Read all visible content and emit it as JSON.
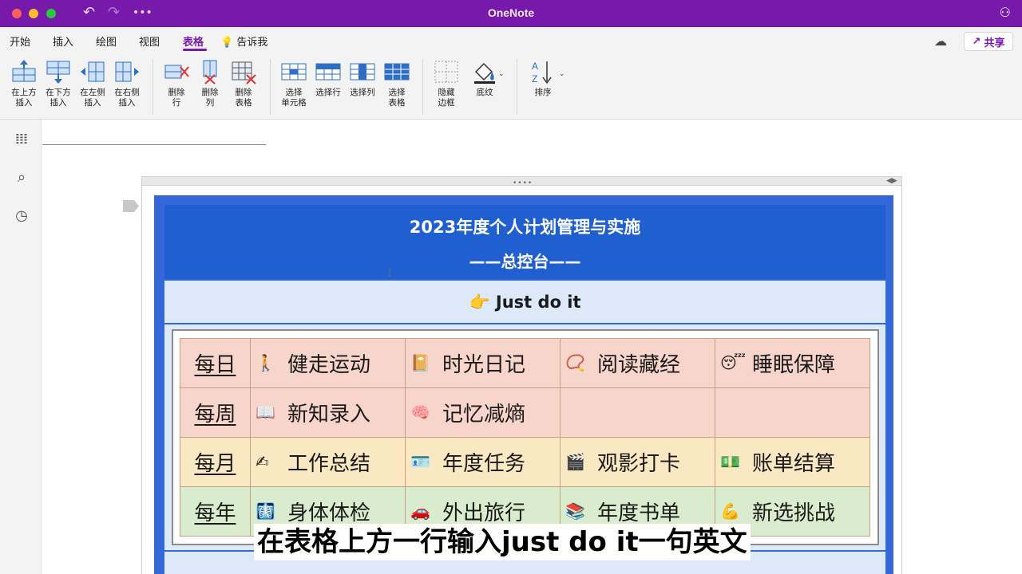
{
  "window": {
    "title": "OneNote",
    "titlebar_icons": [
      "undo-icon",
      "redo-icon",
      "more-icon",
      "account-icon"
    ]
  },
  "tabs": [
    {
      "label": "开始",
      "active": false
    },
    {
      "label": "插入",
      "active": false
    },
    {
      "label": "绘图",
      "active": false
    },
    {
      "label": "视图",
      "active": false
    },
    {
      "label": "表格",
      "active": true
    }
  ],
  "tell_me": "告诉我",
  "share_label": "共享",
  "ribbon": {
    "insert_above": "在上方\n插入",
    "insert_below": "在下方\n插入",
    "insert_left": "在左侧\n插入",
    "insert_right": "在右侧\n插入",
    "delete_row": "删除\n行",
    "delete_col": "删除\n列",
    "delete_table": "删除\n表格",
    "select_cell": "选择\n单元格",
    "select_row": "选择行",
    "select_col": "选择列",
    "select_table": "选择\n表格",
    "hide_borders": "隐藏\n边框",
    "shading": "底纹",
    "sort": "排序"
  },
  "table": {
    "title": "2023年度个人计划管理与实施",
    "subtitle": "——总控台——",
    "motto": "Just do it",
    "motto_icon": "👉",
    "rows": [
      {
        "label": "每日",
        "cells": [
          {
            "icon": "🚶",
            "text": "健走运动"
          },
          {
            "icon": "📔",
            "text": "时光日记"
          },
          {
            "icon": "📿",
            "text": "阅读藏经"
          },
          {
            "icon": "😴",
            "text": "睡眠保障"
          }
        ]
      },
      {
        "label": "每周",
        "cells": [
          {
            "icon": "📖",
            "text": "新知录入"
          },
          {
            "icon": "🧠",
            "text": "记忆减熵"
          },
          {
            "icon": "",
            "text": ""
          },
          {
            "icon": "",
            "text": ""
          }
        ]
      },
      {
        "label": "每月",
        "cells": [
          {
            "icon": "✍",
            "text": "工作总结"
          },
          {
            "icon": "🪪",
            "text": "年度任务"
          },
          {
            "icon": "🎬",
            "text": "观影打卡"
          },
          {
            "icon": "💵",
            "text": "账单结算"
          }
        ]
      },
      {
        "label": "每年",
        "cells": [
          {
            "icon": "🩻",
            "text": "身体体检"
          },
          {
            "icon": "🚗",
            "text": "外出旅行"
          },
          {
            "icon": "📚",
            "text": "年度书单"
          },
          {
            "icon": "💪",
            "text": "新选挑战"
          }
        ]
      }
    ]
  },
  "caption": "在表格上方一行输入just do it一句英文"
}
